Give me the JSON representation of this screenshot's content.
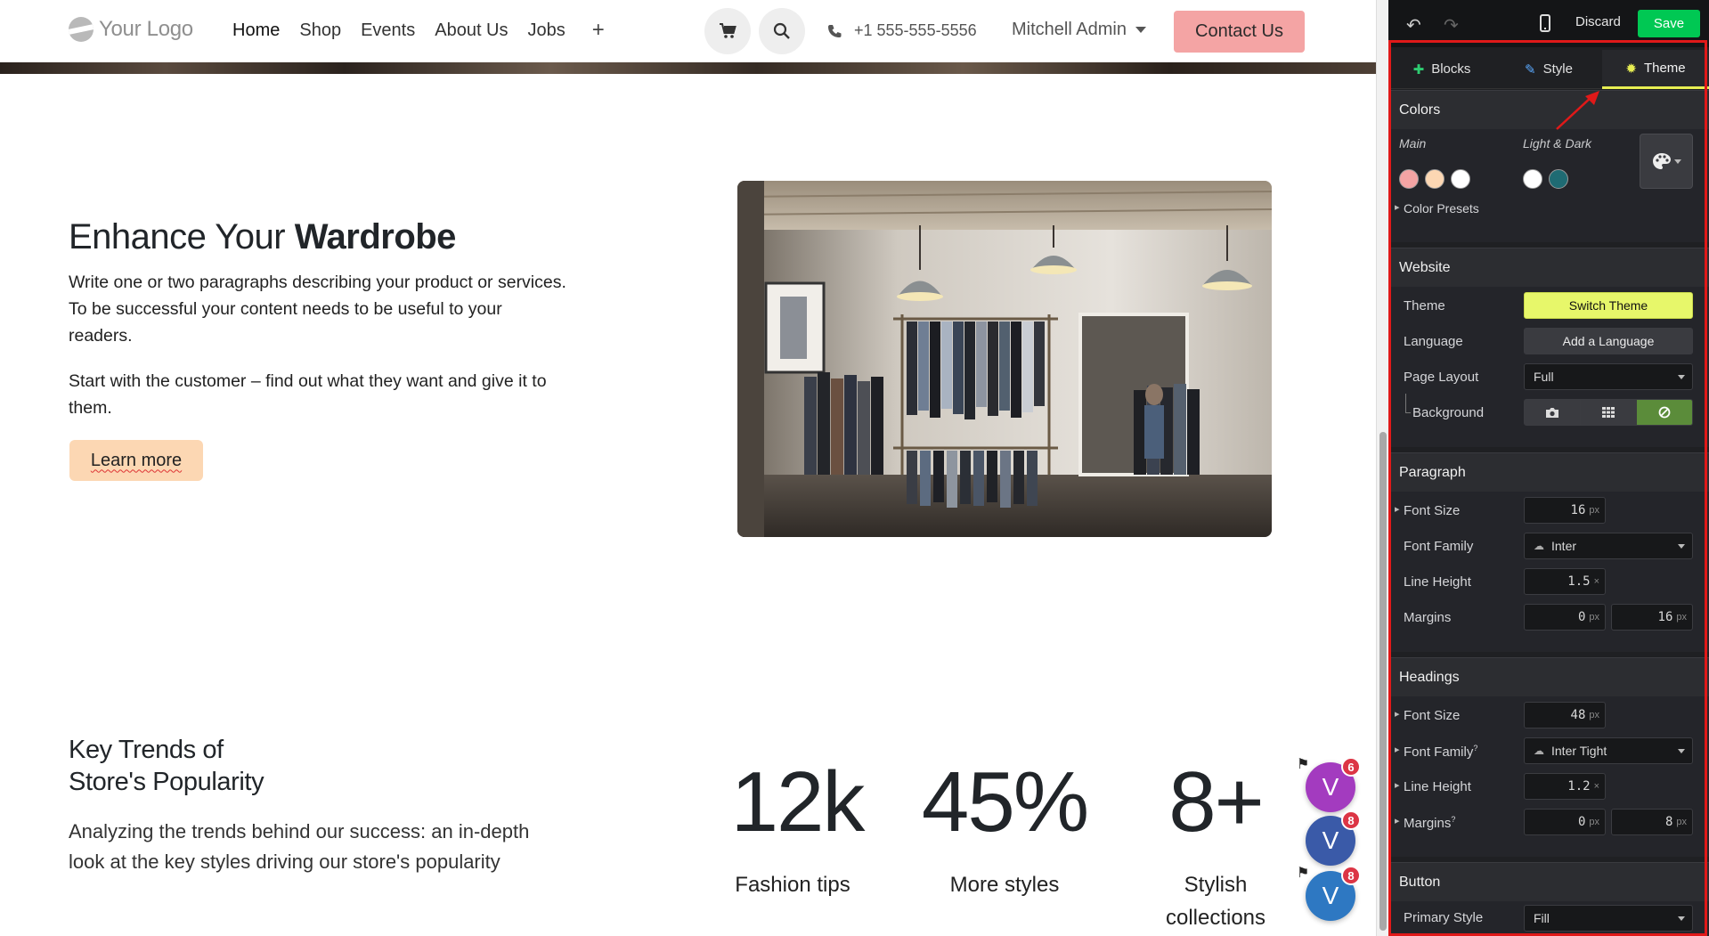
{
  "navbar": {
    "logo_text": "Your Logo",
    "links": [
      "Home",
      "Shop",
      "Events",
      "About Us",
      "Jobs"
    ],
    "plus": "+",
    "phone": "+1 555-555-5556",
    "user": "Mitchell Admin",
    "contact_label": "Contact Us"
  },
  "hero": {
    "title_regular": "Enhance Your ",
    "title_bold": "Wardrobe",
    "paragraph1": "Write one or two paragraphs describing your product or services. To be successful your content needs to be useful to your readers.",
    "paragraph2": "Start with the customer – find out what they want and give it to them.",
    "button_label": "Learn more"
  },
  "trends": {
    "title_line1": "Key Trends of",
    "title_line2": "Store's Popularity",
    "paragraph": "Analyzing the trends behind our success: an in-depth look at the key styles driving our store's popularity",
    "stats": [
      {
        "value": "12k",
        "label": "Fashion tips"
      },
      {
        "value": "45%",
        "label": "More styles"
      },
      {
        "value": "8+",
        "label": "Stylish collections"
      }
    ]
  },
  "chat_bubbles": [
    {
      "letter": "V",
      "badge": "6",
      "color": "#a33bbf"
    },
    {
      "letter": "V",
      "badge": "8",
      "color": "#3a5aa8"
    },
    {
      "letter": "V",
      "badge": "8",
      "color": "#2e78c2"
    }
  ],
  "editor": {
    "discard_label": "Discard",
    "save_label": "Save",
    "tabs": [
      {
        "label": "Blocks",
        "icon": "plus-icon"
      },
      {
        "label": "Style",
        "icon": "pencil-icon"
      },
      {
        "label": "Theme",
        "icon": "gear-icon"
      }
    ],
    "colors": {
      "heading": "Colors",
      "main_label": "Main",
      "light_dark_label": "Light & Dark",
      "main_swatches": [
        "#f4a4a4",
        "#fcd7b3",
        "#ffffff"
      ],
      "light_dark_swatches": [
        "#ffffff",
        "#1f6b73"
      ],
      "presets_label": "Color Presets"
    },
    "website": {
      "heading": "Website",
      "theme_label": "Theme",
      "theme_button": "Switch Theme",
      "language_label": "Language",
      "language_button": "Add a Language",
      "layout_label": "Page Layout",
      "layout_value": "Full",
      "background_label": "Background"
    },
    "paragraph": {
      "heading": "Paragraph",
      "font_size_label": "Font Size",
      "font_size_value": "16",
      "font_family_label": "Font Family",
      "font_family_value": "Inter",
      "line_height_label": "Line Height",
      "line_height_value": "1.5",
      "margins_label": "Margins",
      "margin_top": "0",
      "margin_bottom": "16"
    },
    "headings": {
      "heading": "Headings",
      "font_size_label": "Font Size",
      "font_size_value": "48",
      "font_family_label": "Font Family",
      "font_family_value": "Inter Tight",
      "line_height_label": "Line Height",
      "line_height_value": "1.2",
      "margins_label": "Margins",
      "margin_top": "0",
      "margin_bottom": "8"
    },
    "button": {
      "heading": "Button",
      "primary_style_label": "Primary Style",
      "primary_style_value": "Fill"
    },
    "units": {
      "px": "px",
      "x": "×"
    },
    "superscript": "?"
  },
  "colors": {
    "save_green": "#00c853",
    "switch_theme_yellow": "#e7f76a",
    "active_tab_underline": "#e7ee52",
    "highlight_red": "#e01919",
    "background_active": "#5b8c3a"
  }
}
